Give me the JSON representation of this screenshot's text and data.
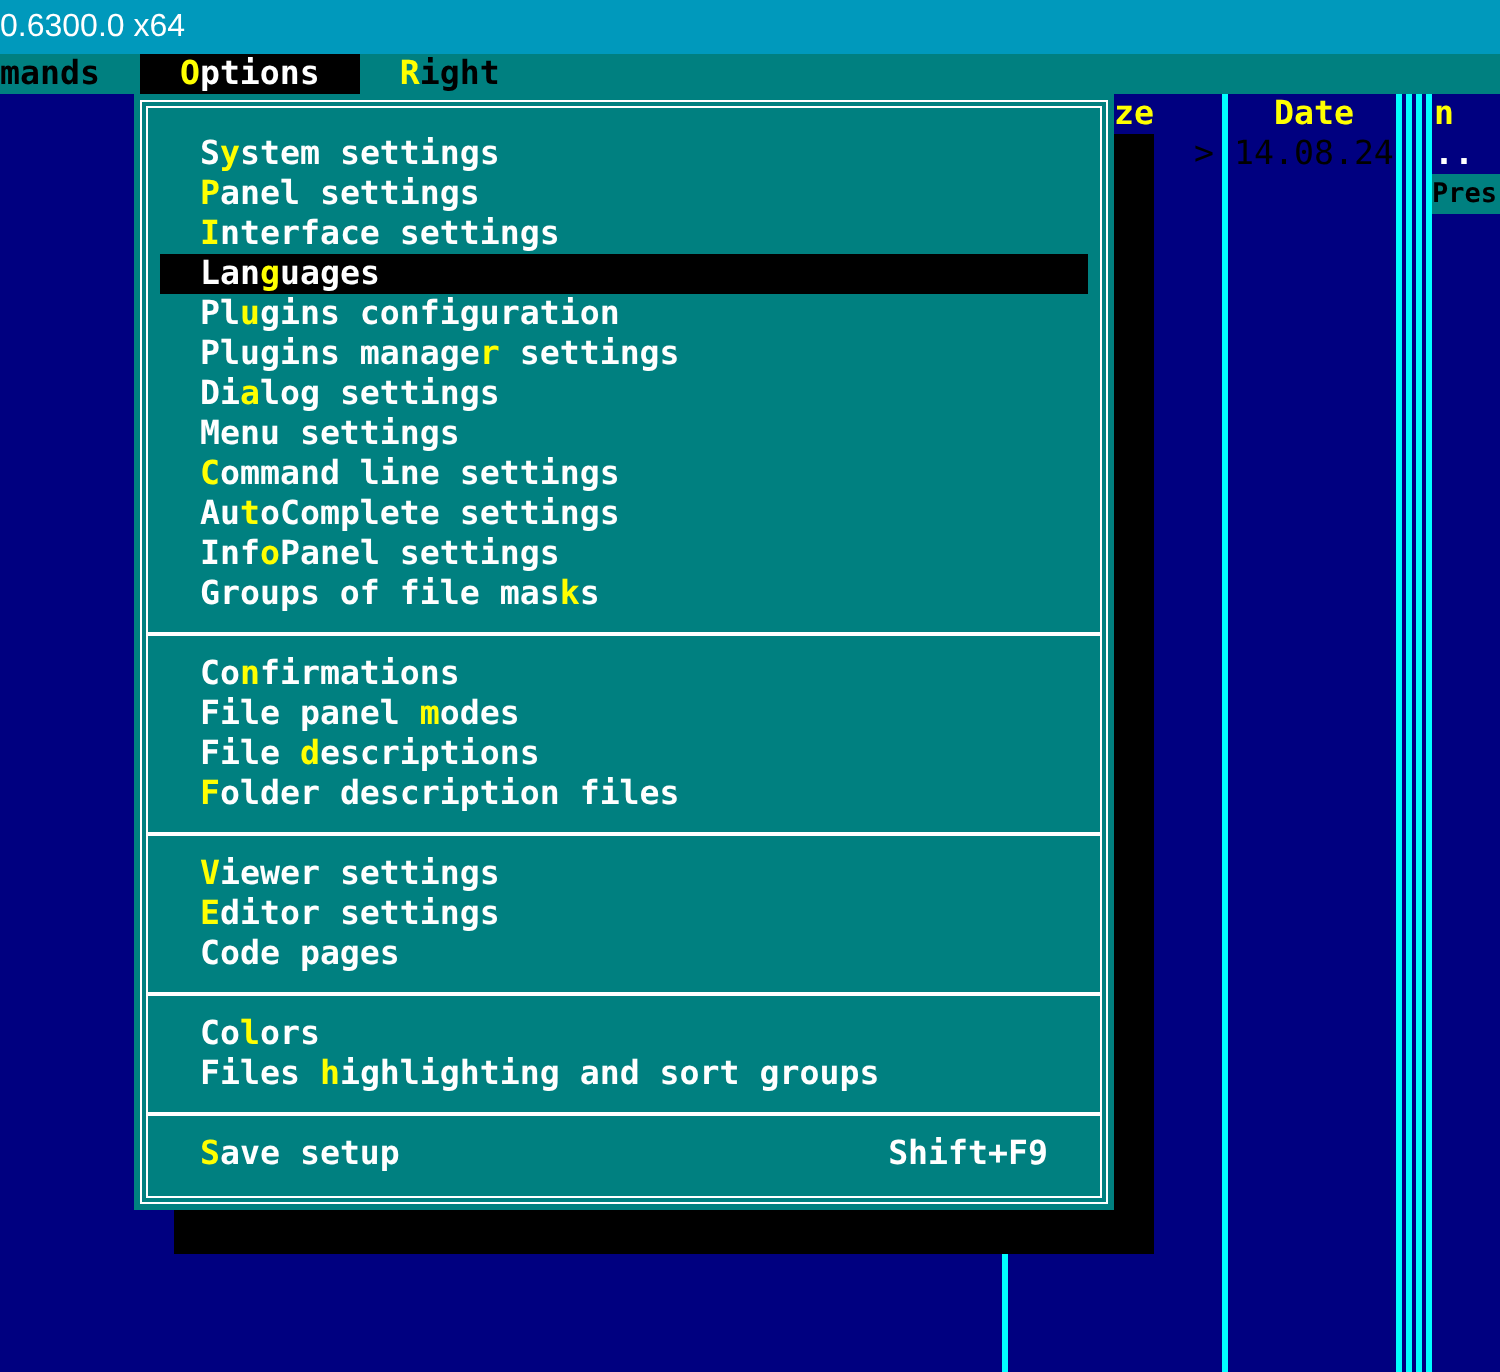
{
  "title_bar": {
    "title": "0.6300.0 x64"
  },
  "menu_bar": [
    {
      "parts": [
        {
          "text": "mands",
          "hot": false
        }
      ],
      "selected": false
    },
    {
      "parts": [
        {
          "text": "O",
          "hot": true
        },
        {
          "text": "ptions",
          "hot": false
        }
      ],
      "selected": true
    },
    {
      "parts": [
        {
          "text": "R",
          "hot": true
        },
        {
          "text": "ight",
          "hot": false
        }
      ],
      "selected": false
    }
  ],
  "panel": {
    "columns": [
      "ze",
      "Date",
      "n"
    ],
    "date_marker": ">",
    "date": "14.08.24",
    "up_entry": "..",
    "status_label": "Pres"
  },
  "options_menu": {
    "groups": [
      {
        "items": [
          {
            "parts": [
              {
                "text": "S",
                "hot": false
              },
              {
                "text": "y",
                "hot": true
              },
              {
                "text": "stem settings",
                "hot": false
              }
            ],
            "selected": false
          },
          {
            "parts": [
              {
                "text": "P",
                "hot": true
              },
              {
                "text": "anel settings",
                "hot": false
              }
            ],
            "selected": false
          },
          {
            "parts": [
              {
                "text": "I",
                "hot": true
              },
              {
                "text": "nterface settings",
                "hot": false
              }
            ],
            "selected": false
          },
          {
            "parts": [
              {
                "text": "Lan",
                "hot": false
              },
              {
                "text": "g",
                "hot": true
              },
              {
                "text": "uages",
                "hot": false
              }
            ],
            "selected": true
          },
          {
            "parts": [
              {
                "text": "Pl",
                "hot": false
              },
              {
                "text": "u",
                "hot": true
              },
              {
                "text": "gins configuration",
                "hot": false
              }
            ],
            "selected": false
          },
          {
            "parts": [
              {
                "text": "Plugins manage",
                "hot": false
              },
              {
                "text": "r",
                "hot": true
              },
              {
                "text": " settings",
                "hot": false
              }
            ],
            "selected": false
          },
          {
            "parts": [
              {
                "text": "Di",
                "hot": false
              },
              {
                "text": "a",
                "hot": true
              },
              {
                "text": "log settings",
                "hot": false
              }
            ],
            "selected": false
          },
          {
            "parts": [
              {
                "text": "Menu settings",
                "hot": false
              }
            ],
            "selected": false
          },
          {
            "parts": [
              {
                "text": "C",
                "hot": true
              },
              {
                "text": "ommand line settings",
                "hot": false
              }
            ],
            "selected": false
          },
          {
            "parts": [
              {
                "text": "Au",
                "hot": false
              },
              {
                "text": "t",
                "hot": true
              },
              {
                "text": "oComplete settings",
                "hot": false
              }
            ],
            "selected": false
          },
          {
            "parts": [
              {
                "text": "Inf",
                "hot": false
              },
              {
                "text": "o",
                "hot": true
              },
              {
                "text": "Panel settings",
                "hot": false
              }
            ],
            "selected": false
          },
          {
            "parts": [
              {
                "text": "Groups of file mas",
                "hot": false
              },
              {
                "text": "k",
                "hot": true
              },
              {
                "text": "s",
                "hot": false
              }
            ],
            "selected": false
          }
        ]
      },
      {
        "items": [
          {
            "parts": [
              {
                "text": "Co",
                "hot": false
              },
              {
                "text": "n",
                "hot": true
              },
              {
                "text": "firmations",
                "hot": false
              }
            ],
            "selected": false
          },
          {
            "parts": [
              {
                "text": "File panel ",
                "hot": false
              },
              {
                "text": "m",
                "hot": true
              },
              {
                "text": "odes",
                "hot": false
              }
            ],
            "selected": false
          },
          {
            "parts": [
              {
                "text": "File ",
                "hot": false
              },
              {
                "text": "d",
                "hot": true
              },
              {
                "text": "escriptions",
                "hot": false
              }
            ],
            "selected": false
          },
          {
            "parts": [
              {
                "text": "F",
                "hot": true
              },
              {
                "text": "older description files",
                "hot": false
              }
            ],
            "selected": false
          }
        ]
      },
      {
        "items": [
          {
            "parts": [
              {
                "text": "V",
                "hot": true
              },
              {
                "text": "iewer settings",
                "hot": false
              }
            ],
            "selected": false
          },
          {
            "parts": [
              {
                "text": "E",
                "hot": true
              },
              {
                "text": "ditor settings",
                "hot": false
              }
            ],
            "selected": false
          },
          {
            "parts": [
              {
                "text": "Code pages",
                "hot": false
              }
            ],
            "selected": false
          }
        ]
      },
      {
        "items": [
          {
            "parts": [
              {
                "text": "Co",
                "hot": false
              },
              {
                "text": "l",
                "hot": true
              },
              {
                "text": "ors",
                "hot": false
              }
            ],
            "selected": false
          },
          {
            "parts": [
              {
                "text": "Files ",
                "hot": false
              },
              {
                "text": "h",
                "hot": true
              },
              {
                "text": "ighlighting and sort groups",
                "hot": false
              }
            ],
            "selected": false
          }
        ]
      },
      {
        "items": [
          {
            "parts": [
              {
                "text": "S",
                "hot": true
              },
              {
                "text": "ave setup",
                "hot": false
              }
            ],
            "selected": false,
            "shortcut": "Shift+F9"
          }
        ]
      }
    ]
  }
}
